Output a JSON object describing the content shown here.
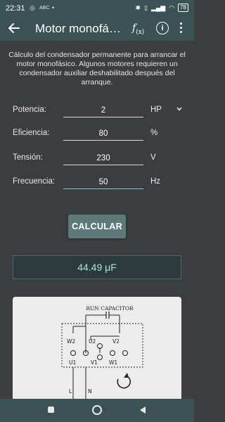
{
  "status": {
    "time": "22:31",
    "left_icons": [
      "whatsapp-icon",
      "abc-icon",
      "dot-icon"
    ],
    "battery": "78"
  },
  "appbar": {
    "title": "Motor monofásico",
    "fx_label": "f",
    "fx_sub": "(x)",
    "info_label": "i"
  },
  "description": "Cálculo del condensador permanente para arrancar el motor monofásico. Algunos motores requieren un condensador auxiliar deshabilitado después del arranque.",
  "form": {
    "power": {
      "label": "Potencia:",
      "value": "2",
      "unit": "HP"
    },
    "efficiency": {
      "label": "Eficiencia:",
      "value": "80",
      "unit": "%"
    },
    "voltage": {
      "label": "Tensión:",
      "value": "230",
      "unit": "V"
    },
    "frequency": {
      "label": "Frecuencia:",
      "value": "50",
      "unit": "Hz"
    }
  },
  "calc_button": "CALCULAR",
  "result": "44.49 μF",
  "diagram": {
    "title": "RUN CAPACITOR",
    "terminals": [
      "W2",
      "U2",
      "V2",
      "U1",
      "V1",
      "W1"
    ],
    "lines": [
      "L",
      "N"
    ]
  },
  "colors": {
    "background": "#3b3d40",
    "bars": "#3a5253",
    "accent": "#7fd1d1",
    "button": "#5d7a7b",
    "result_text": "#a7e6e3"
  }
}
